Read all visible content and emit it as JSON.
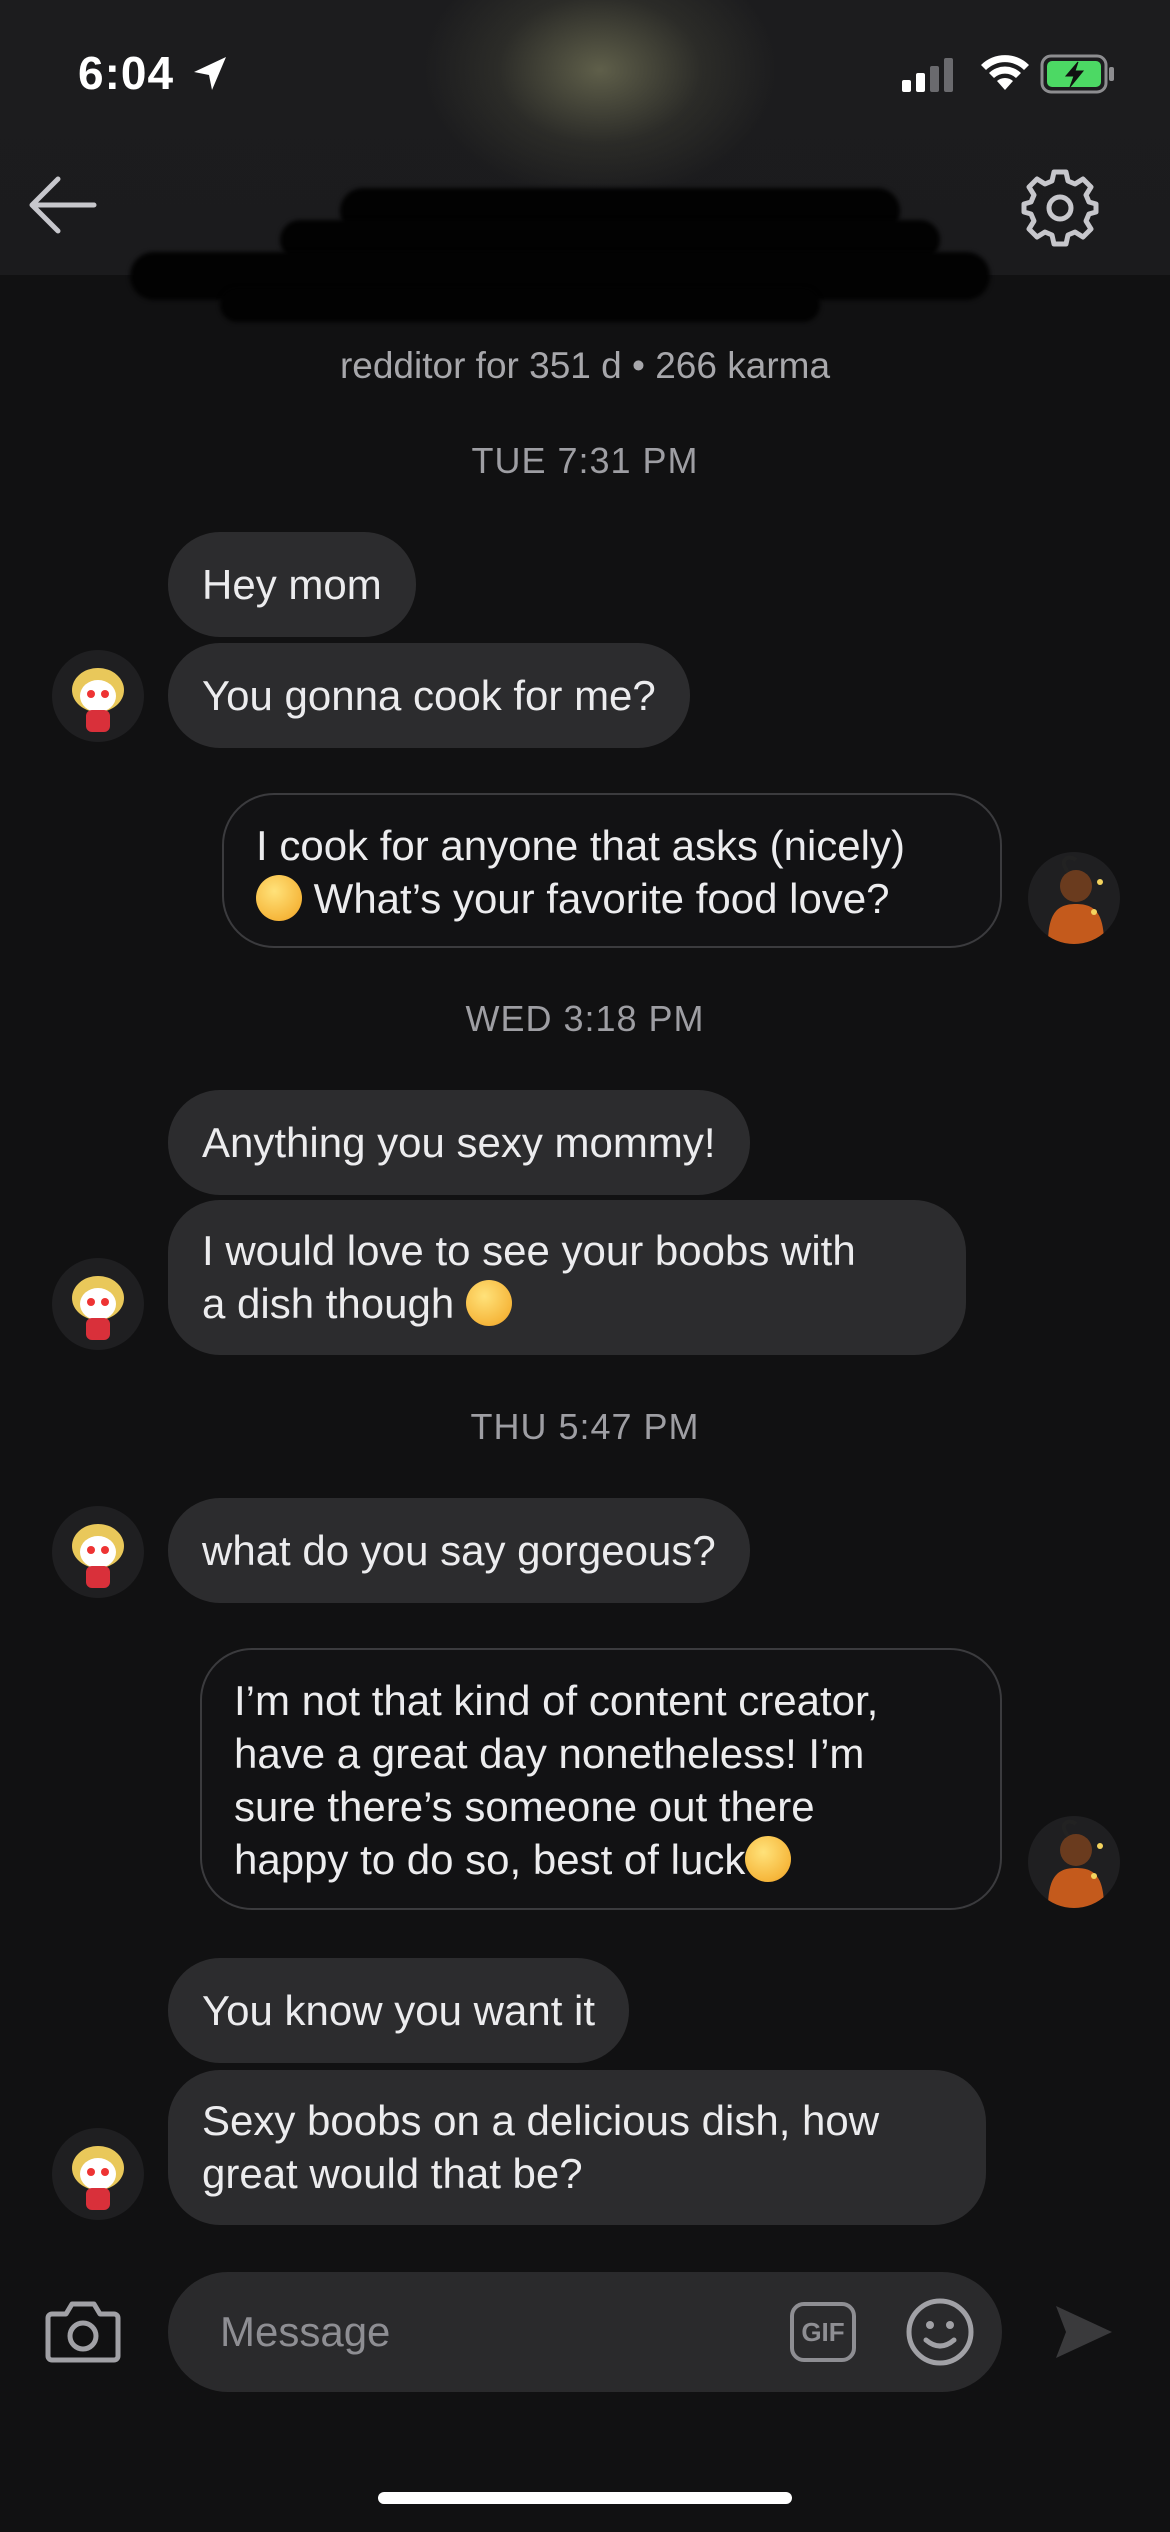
{
  "status_bar": {
    "time": "6:04"
  },
  "header": {
    "back_icon": "arrow-left-icon",
    "settings_icon": "gear-icon",
    "user_meta": "redditor for 351 d • 266 karma"
  },
  "dates": [
    "TUE 7:31 PM",
    "WED 3:18 PM",
    "THU 5:47 PM"
  ],
  "messages": {
    "m1": "Hey mom",
    "m2": "You gonna cook for me?",
    "m3_line1": "I cook for anyone that asks (nicely)",
    "m3_line2": "What’s your favorite food love?",
    "m4": "Anything you sexy mommy!",
    "m5_line1": "I would love to see your boobs with",
    "m5_line2": "a dish though",
    "m6": "what do you say gorgeous?",
    "m7_line1": "I’m not that kind of content creator,",
    "m7_line2": "have a great day nonetheless! I’m",
    "m7_line3": "sure there’s someone out there",
    "m7_line4": "happy to do so, best of luck",
    "m8": "You know you want it",
    "m9_line1": "Sexy boobs on a delicious dish, how",
    "m9_line2": "great would that be?"
  },
  "composer": {
    "placeholder": "Message",
    "gif_label": "GIF"
  },
  "colors": {
    "background": "#111112",
    "bubble_incoming": "#2c2c2e",
    "bubble_outgoing_border": "#3b3b3e",
    "battery_accent": "#4cd964"
  }
}
